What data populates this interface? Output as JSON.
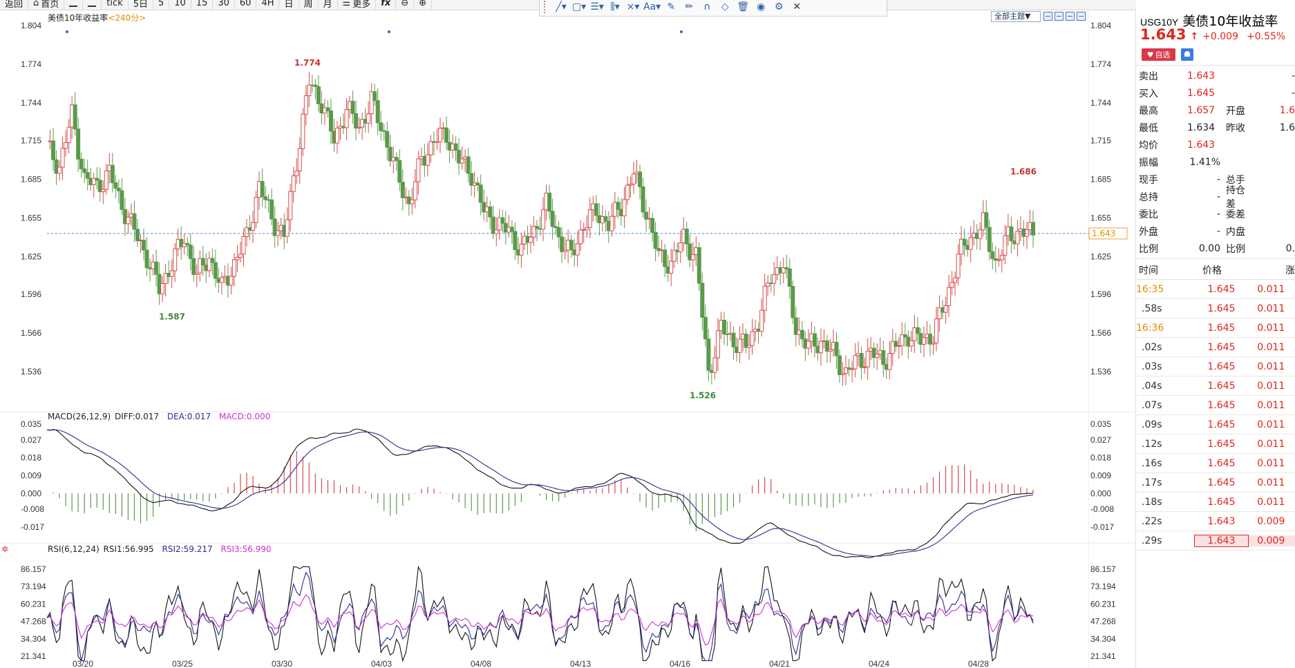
{
  "toolbar": {
    "items": [
      "返回",
      "首页",
      "",
      "",
      "tick",
      "5日",
      "5",
      "10",
      "15",
      "30",
      "60",
      "4H",
      "日",
      "周",
      "月",
      "更多",
      "fx",
      "",
      ""
    ]
  },
  "chart": {
    "title": "美债10年收益率",
    "period": "<240分>",
    "theme_button": "全部主题▼",
    "y_ticks": [
      "1.804",
      "1.774",
      "1.744",
      "1.715",
      "1.685",
      "1.655",
      "1.625",
      "1.596",
      "1.566",
      "1.536"
    ],
    "last_price": "1.643",
    "high_marker": "1.774",
    "low_marker_1": "1.587",
    "low_marker_2": "1.526",
    "right_high_marker": "1.686",
    "x_ticks": [
      "03/20",
      "03/25",
      "03/30",
      "04/03",
      "04/08",
      "04/13",
      "04/16",
      "04/21",
      "04/24",
      "04/28"
    ]
  },
  "macd": {
    "name": "MACD(26,12,9)",
    "diff": "DIFF:0.017",
    "dea": "DEA:0.017",
    "macd": "MACD:0.000",
    "ticks": [
      "0.035",
      "0.027",
      "0.018",
      "0.009",
      "0.000",
      "-0.008",
      "-0.017"
    ]
  },
  "rsi": {
    "name": "RSI(6,12,24)",
    "rsi1": "RSI1:56.995",
    "rsi2": "RSI2:59.217",
    "rsi3": "RSI3:56.990",
    "ticks": [
      "86.157",
      "73.194",
      "60.231",
      "47.268",
      "34.304",
      "21.341"
    ]
  },
  "panel": {
    "code": "USG10Y",
    "name": "美债10年收益率",
    "price": "1.643",
    "change": "+0.009",
    "change_pct": "+0.55%",
    "fav_label": "自选",
    "quotes": [
      {
        "l1": "卖出",
        "v1": "1.643",
        "l2": "",
        "v2": "-"
      },
      {
        "l1": "买入",
        "v1": "1.645",
        "l2": "",
        "v2": "-"
      },
      {
        "l1": "最高",
        "v1": "1.657",
        "l2": "开盘",
        "v2": "1.6"
      },
      {
        "l1": "最低",
        "v1": "1.634",
        "l2": "昨收",
        "v2": "1.6"
      },
      {
        "l1": "均价",
        "v1": "1.643",
        "l2": "",
        "v2": ""
      },
      {
        "l1": "振幅",
        "v1": "1.41%",
        "l2": "",
        "v2": ""
      },
      {
        "l1": "现手",
        "v1": "-",
        "l2": "总手",
        "v2": ""
      },
      {
        "l1": "总持",
        "v1": "-",
        "l2": "持仓差",
        "v2": ""
      },
      {
        "l1": "委比",
        "v1": "-",
        "l2": "委差",
        "v2": ""
      },
      {
        "l1": "外盘",
        "v1": "-",
        "l2": "内盘",
        "v2": ""
      },
      {
        "l1": "比例",
        "v1": "0.00",
        "l2": "比例",
        "v2": "0."
      }
    ],
    "tick_header": {
      "time": "时间",
      "price": "价格",
      "change": "涨"
    },
    "ticks": [
      {
        "time": "16:35",
        "price": "1.645",
        "chg": "0.011"
      },
      {
        "time": ".58s",
        "price": "1.645",
        "chg": "0.011"
      },
      {
        "time": "16:36",
        "price": "1.645",
        "chg": "0.011"
      },
      {
        "time": ".02s",
        "price": "1.645",
        "chg": "0.011"
      },
      {
        "time": ".03s",
        "price": "1.645",
        "chg": "0.011"
      },
      {
        "time": ".04s",
        "price": "1.645",
        "chg": "0.011"
      },
      {
        "time": ".07s",
        "price": "1.645",
        "chg": "0.011"
      },
      {
        "time": ".09s",
        "price": "1.645",
        "chg": "0.011"
      },
      {
        "time": ".12s",
        "price": "1.645",
        "chg": "0.011"
      },
      {
        "time": ".16s",
        "price": "1.645",
        "chg": "0.011"
      },
      {
        "time": ".17s",
        "price": "1.645",
        "chg": "0.011"
      },
      {
        "time": ".18s",
        "price": "1.645",
        "chg": "0.011"
      },
      {
        "time": ".22s",
        "price": "1.643",
        "chg": "0.009"
      },
      {
        "time": ".29s",
        "price": "1.643",
        "chg": "0.009"
      }
    ]
  },
  "colors": {
    "up": "#d84a4a",
    "down": "#5a9a4a",
    "accent": "#e0251b",
    "dea": "#2b2b8c",
    "rsi3": "#cc33cc"
  }
}
